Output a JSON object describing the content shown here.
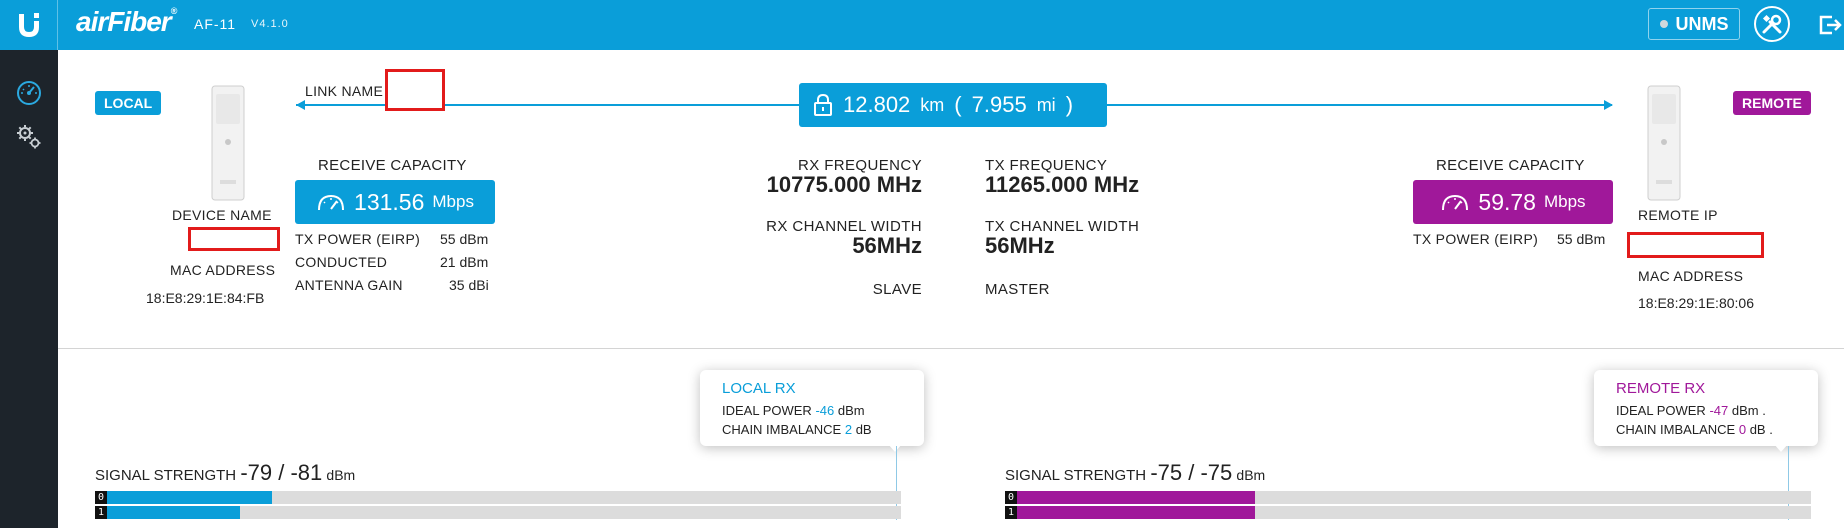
{
  "header": {
    "brand": "airFiber",
    "brand_mark": "®",
    "model": "AF-11",
    "version": "V4.1.0",
    "unms_label": "UNMS"
  },
  "colors": {
    "accent": "#0a9ed9",
    "remote": "#a0189a",
    "sidebar": "#1d242b",
    "highlight": "#e21b1b"
  },
  "link": {
    "link_name_label": "LINK NAME",
    "distance_km": "12.802",
    "km_unit": "km",
    "paren_open": "(",
    "distance_mi": "7.955",
    "mi_unit": "mi",
    "paren_close": ")"
  },
  "local": {
    "badge": "LOCAL",
    "device_name_label": "DEVICE NAME",
    "mac_label": "MAC ADDRESS",
    "mac_value": "18:E8:29:1E:84:FB",
    "receive_capacity_label": "RECEIVE CAPACITY",
    "capacity_value": "131.56",
    "capacity_unit": "Mbps",
    "tx_power_label": "TX POWER (EIRP)",
    "tx_power_value": "55 dBm",
    "conducted_label": "CONDUCTED",
    "conducted_value": "21 dBm",
    "antenna_gain_label": "ANTENNA GAIN",
    "antenna_gain_value": "35 dBi"
  },
  "remote": {
    "badge": "REMOTE",
    "remote_ip_label": "REMOTE IP",
    "mac_label": "MAC ADDRESS",
    "mac_value": "18:E8:29:1E:80:06",
    "receive_capacity_label": "RECEIVE CAPACITY",
    "capacity_value": "59.78",
    "capacity_unit": "Mbps",
    "tx_power_label": "TX POWER (EIRP)",
    "tx_power_value": "55 dBm"
  },
  "radio": {
    "rx_freq_label": "RX FREQUENCY",
    "rx_freq_value": "10775.000 MHz",
    "tx_freq_label": "TX FREQUENCY",
    "tx_freq_value": "11265.000 MHz",
    "rx_width_label": "RX CHANNEL WIDTH",
    "rx_width_value": "56MHz",
    "tx_width_label": "TX CHANNEL WIDTH",
    "tx_width_value": "56MHz",
    "local_role": "SLAVE",
    "remote_role": "MASTER"
  },
  "signal": {
    "local": {
      "title": "LOCAL RX",
      "ideal_power_label": "IDEAL POWER",
      "ideal_power_value": "-46",
      "ideal_power_unit": "dBm",
      "chain_imbalance_label": "CHAIN IMBALANCE",
      "chain_imbalance_value": "2",
      "chain_imbalance_unit": "dB",
      "strength_label": "SIGNAL STRENGTH",
      "strength_value": "-79 / -81",
      "strength_unit": "dBm",
      "chain0_label": "0",
      "chain1_label": "1",
      "chain0_fill": 0.22,
      "chain1_fill": 0.18
    },
    "remote": {
      "title": "REMOTE RX",
      "ideal_power_label": "IDEAL POWER",
      "ideal_power_value": "-47",
      "ideal_power_unit": "dBm .",
      "chain_imbalance_label": "CHAIN IMBALANCE",
      "chain_imbalance_value": "0",
      "chain_imbalance_unit": "dB .",
      "strength_label": "SIGNAL STRENGTH",
      "strength_value": "-75 / -75",
      "strength_unit": "dBm",
      "chain0_label": "0",
      "chain1_label": "1",
      "chain0_fill": 0.31,
      "chain1_fill": 0.31
    }
  }
}
